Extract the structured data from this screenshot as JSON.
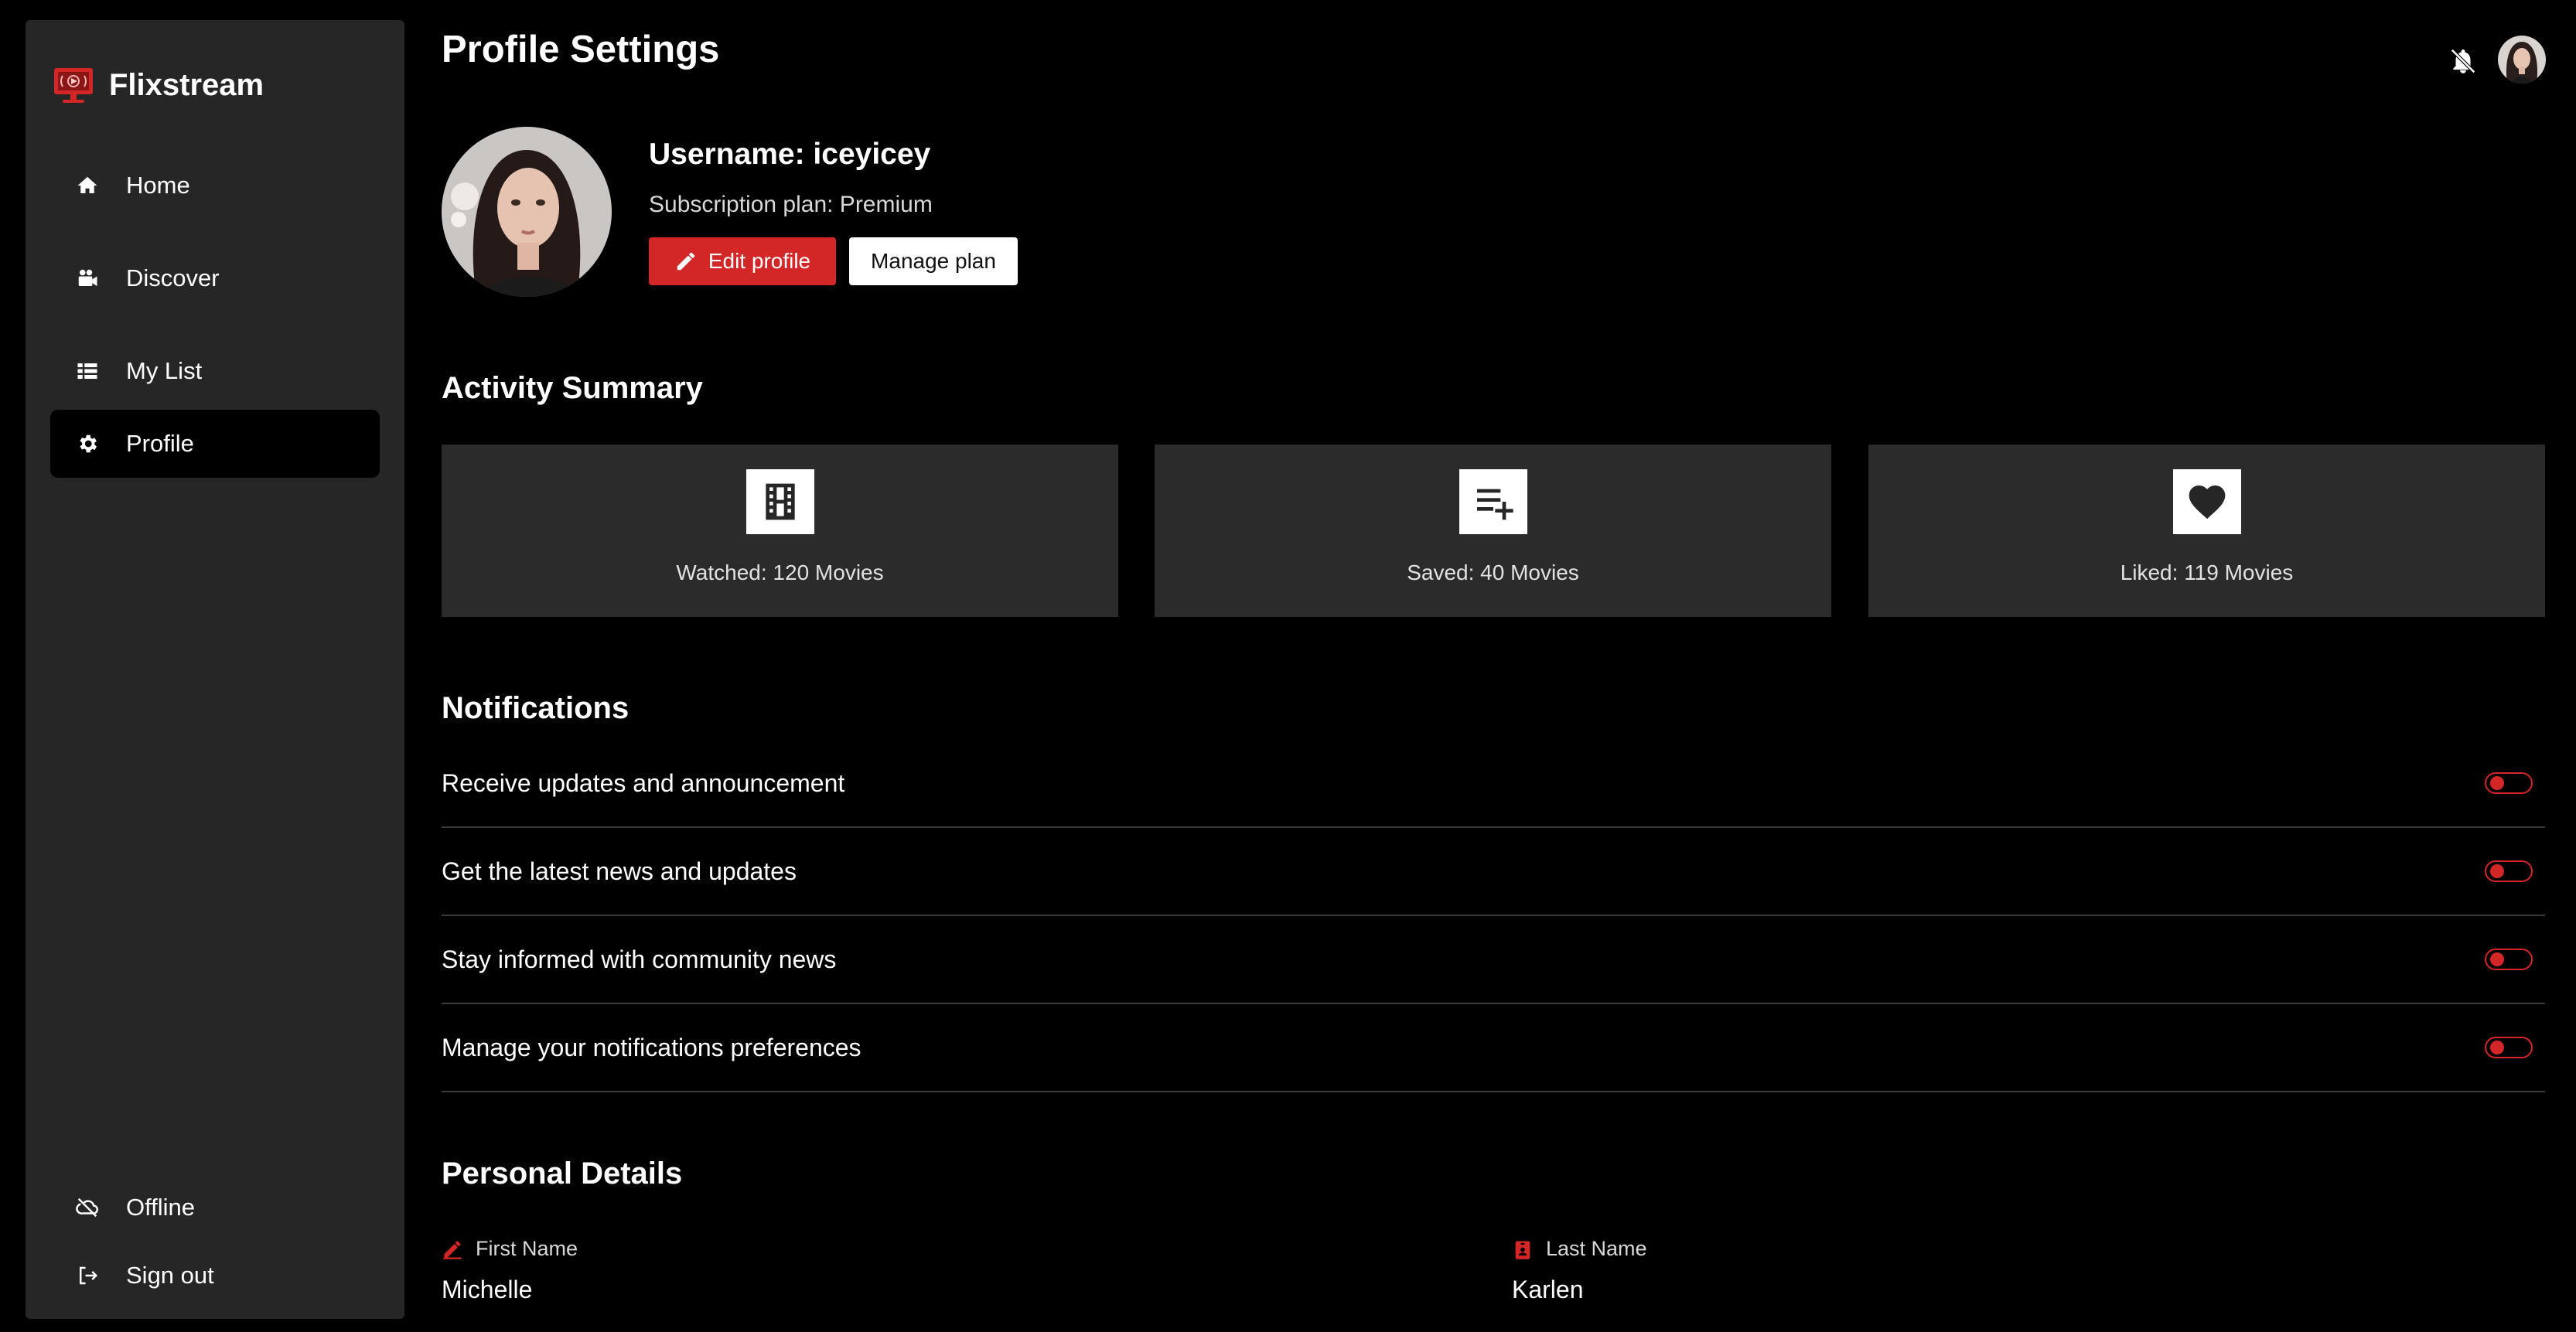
{
  "brand": {
    "name": "Flixstream",
    "accent": "#d32626"
  },
  "nav": {
    "main": [
      {
        "label": "Home",
        "icon": "home-icon"
      },
      {
        "label": "Discover",
        "icon": "camera-icon"
      },
      {
        "label": "My List",
        "icon": "list-icon"
      },
      {
        "label": "Profile",
        "icon": "gear-icon",
        "active": true
      }
    ],
    "bottom": [
      {
        "label": "Offline",
        "icon": "cloud-off-icon"
      },
      {
        "label": "Sign out",
        "icon": "sign-out-icon"
      }
    ]
  },
  "header": {
    "title": "Profile Settings",
    "bell_icon": "notifications-off-icon"
  },
  "profile": {
    "username": "Username: iceyicey",
    "plan": "Subscription plan: Premium",
    "edit_label": "Edit profile",
    "manage_label": "Manage plan"
  },
  "activity": {
    "title": "Activity Summary",
    "cards": [
      {
        "label": "Watched:",
        "value": "120 Movies",
        "icon": "film-icon"
      },
      {
        "label": "Saved:",
        "value": "40 Movies",
        "icon": "playlist-add-icon"
      },
      {
        "label": "Liked:",
        "value": "119 Movies",
        "icon": "heart-icon"
      }
    ]
  },
  "notifications": {
    "title": "Notifications",
    "items": [
      {
        "label": "Receive updates and announcement",
        "enabled": false
      },
      {
        "label": "Get the latest news and updates",
        "enabled": false
      },
      {
        "label": "Stay informed with community news",
        "enabled": false
      },
      {
        "label": "Manage your notifications preferences",
        "enabled": false
      }
    ]
  },
  "personal": {
    "title": "Personal Details",
    "first_name_label": "First Name",
    "first_name": "Michelle",
    "last_name_label": "Last Name",
    "last_name": "Karlen"
  }
}
